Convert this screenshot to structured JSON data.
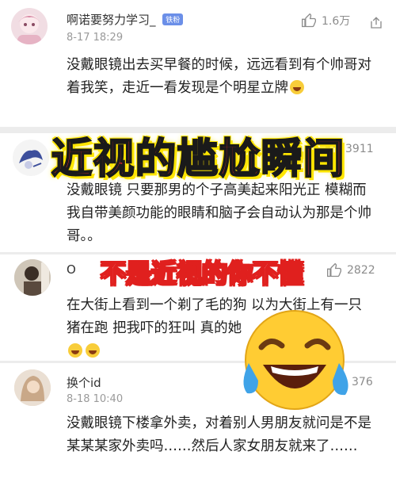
{
  "comments": [
    {
      "username": "啊诺要努力学习_",
      "badge": "铁粉",
      "date": "8-17 18:29",
      "likes": "1.6万",
      "text": "没戴眼镜出去买早餐的时候，远远看到有个帅哥对着我笑，走近一看发现是个明星立牌"
    },
    {
      "username": "",
      "date": "",
      "likes": "3911",
      "text": "没戴眼镜 只要那男的个子高美起来阳光正 模糊而我自带美颜功能的眼睛和脑子会自动认为那是个帅哥。。"
    },
    {
      "username": "O",
      "date": "",
      "likes": "2822",
      "text": "在大街上看到一个剃了毛的狗 以为大街上有一只猪在跑 把我吓的狂叫 真的她"
    },
    {
      "username": "换个id",
      "date": "8-18 10:40",
      "likes": "376",
      "text": "没戴眼镜下楼拿外卖，对着别人男朋友就问是不是某某某家外卖吗……然后人家女朋友就来了……"
    }
  ],
  "overlay": {
    "title": "近视的尴尬瞬间",
    "subtitle": "不是近视的你不懂"
  },
  "icons": {
    "like": "thumbs-up-icon",
    "share": "share-icon",
    "emoji_big": "tears-of-joy-emoji",
    "emoji_small": "grinning-emoji"
  },
  "colors": {
    "title_red": "#ff2b2b",
    "title_outline": "#ffe500",
    "subtitle_red": "#e0201e",
    "badge_blue": "#6b8fe8"
  }
}
